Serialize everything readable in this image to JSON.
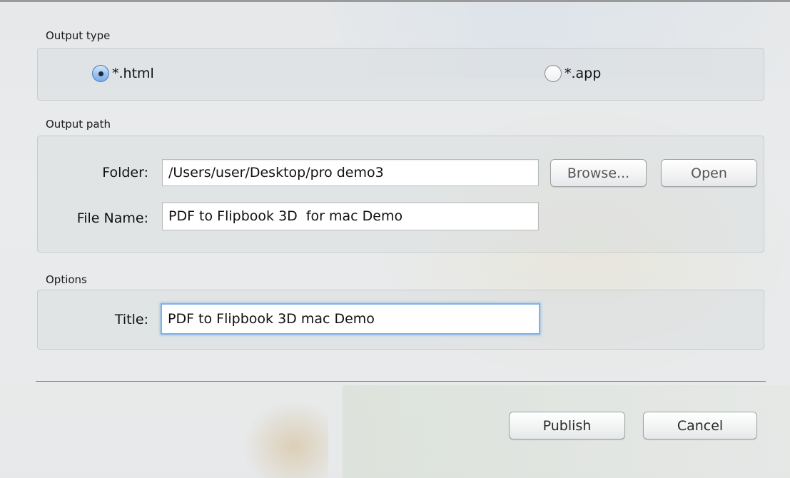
{
  "output_type": {
    "label": "Output type",
    "options": [
      {
        "label": "*.html",
        "selected": true
      },
      {
        "label": "*.app",
        "selected": false
      }
    ]
  },
  "output_path": {
    "label": "Output path",
    "folder": {
      "label": "Folder:",
      "value": "/Users/user/Desktop/pro demo3",
      "browse_label": "Browse...",
      "open_label": "Open"
    },
    "file_name": {
      "label": "File Name:",
      "value": "PDF to Flipbook 3D  for mac Demo"
    }
  },
  "options": {
    "label": "Options",
    "title": {
      "label": "Title:",
      "value": "PDF to Flipbook 3D mac Demo"
    }
  },
  "actions": {
    "publish_label": "Publish",
    "cancel_label": "Cancel"
  }
}
